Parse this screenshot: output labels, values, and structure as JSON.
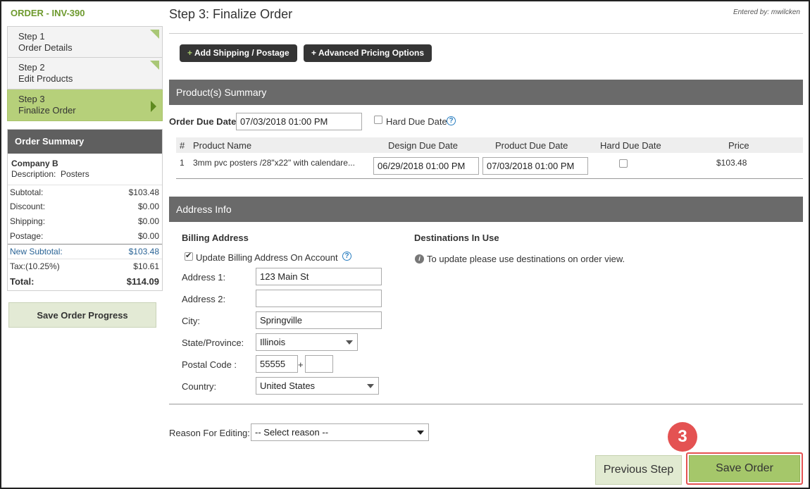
{
  "sidebar": {
    "order_title": "ORDER - INV-390",
    "steps": [
      {
        "step": "Step 1",
        "name": "Order Details"
      },
      {
        "step": "Step 2",
        "name": "Edit Products"
      },
      {
        "step": "Step 3",
        "name": "Finalize Order"
      }
    ],
    "summary": {
      "heading": "Order Summary",
      "company": "Company B",
      "description_label": "Description:",
      "description_value": "Posters",
      "rows": [
        {
          "label": "Subtotal:",
          "value": "$103.48"
        },
        {
          "label": "Discount:",
          "value": "$0.00"
        },
        {
          "label": "Shipping:",
          "value": "$0.00"
        },
        {
          "label": "Postage:",
          "value": "$0.00"
        },
        {
          "label": "New Subtotal:",
          "value": "$103.48"
        },
        {
          "label": "Tax:(10.25%)",
          "value": "$10.61"
        },
        {
          "label": "Total:",
          "value": "$114.09"
        }
      ]
    },
    "save_progress": "Save Order Progress"
  },
  "main": {
    "title": "Step 3: Finalize Order",
    "entered_by": "Entered by: mwilcken",
    "add_shipping": "Add Shipping / Postage",
    "advanced_pricing": "Advanced Pricing Options",
    "plus": "+",
    "products_section": "Product(s) Summary",
    "order_due_label": "Order Due Date:",
    "order_due_value": "07/03/2018 01:00 PM",
    "hard_due_label": "Hard Due Date",
    "help_glyph": "?",
    "table": {
      "headers": [
        "#",
        "Product Name",
        "Design Due Date",
        "Product Due Date",
        "Hard Due Date",
        "Price"
      ],
      "row": {
        "num": "1",
        "name": "3mm pvc posters /28\"x22\" with calendare...",
        "design_due": "06/29/2018 01:00 PM",
        "product_due": "07/03/2018 01:00 PM",
        "price": "$103.48"
      }
    },
    "address_section": "Address Info",
    "billing_heading": "Billing Address",
    "update_billing": "Update Billing Address On Account",
    "destinations_heading": "Destinations In Use",
    "destinations_note": "To update please use destinations on order view.",
    "info_glyph": "i",
    "fields": {
      "address1_label": "Address 1:",
      "address1_value": "123 Main St",
      "address2_label": "Address 2:",
      "address2_value": "",
      "city_label": "City:",
      "city_value": "Springville",
      "state_label": "State/Province:",
      "state_value": "Illinois",
      "postal_label": "Postal Code :",
      "postal_value": "55555",
      "postal_plus": "+",
      "postal_ext": "",
      "country_label": "Country:",
      "country_value": "United States"
    },
    "reason_label": "Reason For Editing:",
    "reason_value": "-- Select reason --",
    "previous_step": "Previous Step",
    "save_order": "Save Order",
    "badge": "3"
  },
  "colors": {
    "accent_green": "#a5c76a",
    "section_gray": "#6a6a6a",
    "highlight_red": "#e45252"
  }
}
